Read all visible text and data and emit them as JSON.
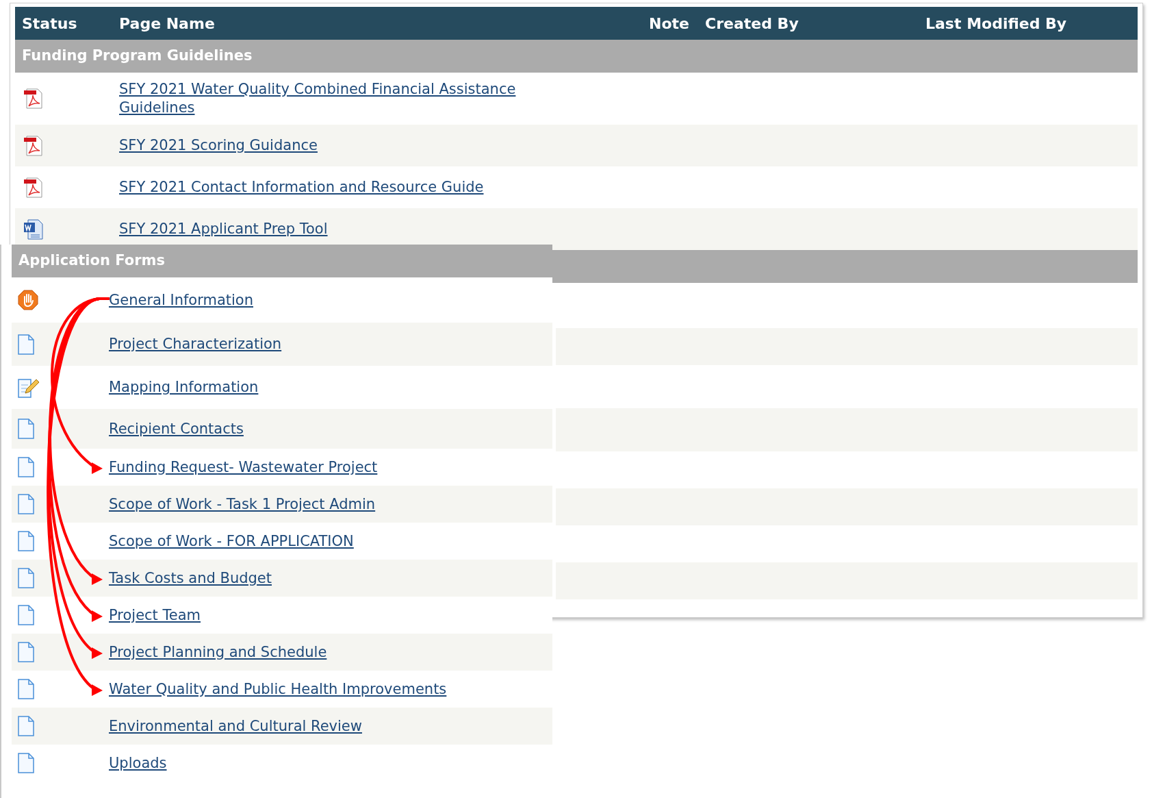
{
  "table": {
    "columns": [
      "Status",
      "Page Name",
      "Note",
      "Created By",
      "Last Modified By"
    ],
    "sections": [
      {
        "title": "Funding Program Guidelines",
        "rows": [
          {
            "kind": "pdf",
            "name": "SFY 2021 Water Quality Combined Financial Assistance Guidelines"
          },
          {
            "kind": "pdf",
            "name": "SFY 2021 Scoring Guidance"
          },
          {
            "kind": "pdf",
            "name": "SFY 2021 Contact Information and Resource Guide"
          },
          {
            "kind": "word",
            "name": "SFY 2021 Applicant Prep Tool"
          }
        ]
      },
      {
        "title": "Application Forms",
        "rows": [
          {
            "kind": "stop",
            "name": "General Information",
            "arrow_source": true,
            "arrow_target": false
          },
          {
            "kind": "page",
            "name": "Project Characterization",
            "arrow_source": false,
            "arrow_target": false
          },
          {
            "kind": "edit",
            "name": "Mapping Information",
            "arrow_source": false,
            "arrow_target": false
          },
          {
            "kind": "page",
            "name": "Recipient Contacts",
            "arrow_source": false,
            "arrow_target": false
          },
          {
            "kind": "page",
            "name": "Funding Request- Wastewater Project",
            "arrow_source": false,
            "arrow_target": true
          },
          {
            "kind": "page",
            "name": "Scope of Work - Task 1 Project Admin",
            "arrow_source": false,
            "arrow_target": false
          },
          {
            "kind": "page",
            "name": "Scope of Work - FOR APPLICATION",
            "arrow_source": false,
            "arrow_target": false
          },
          {
            "kind": "page",
            "name": "Task Costs and Budget",
            "arrow_source": false,
            "arrow_target": true
          },
          {
            "kind": "page",
            "name": "Project Team",
            "arrow_source": false,
            "arrow_target": true
          },
          {
            "kind": "page",
            "name": "Project Planning and Schedule",
            "arrow_source": false,
            "arrow_target": true
          },
          {
            "kind": "page",
            "name": "Water Quality and Public Health Improvements",
            "arrow_source": false,
            "arrow_target": true
          },
          {
            "kind": "page",
            "name": "Environmental and Cultural Review",
            "arrow_source": false,
            "arrow_target": false
          },
          {
            "kind": "page",
            "name": "Uploads",
            "arrow_source": false,
            "arrow_target": false
          }
        ]
      }
    ]
  }
}
